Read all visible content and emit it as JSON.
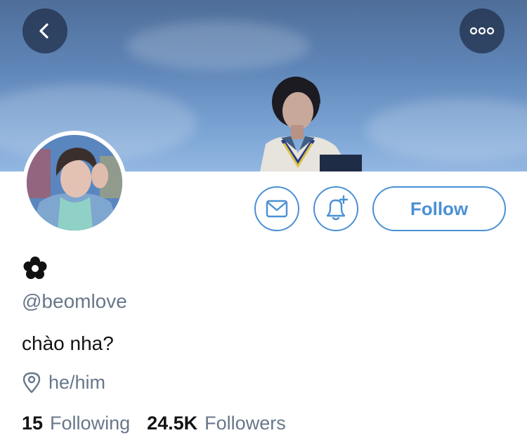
{
  "header": {
    "back_icon": "chevron-left-icon",
    "more_icon": "more-horizontal-icon"
  },
  "profile": {
    "display_name_icon": "flower-icon",
    "handle": "@beomlove",
    "bio": "chào nha?",
    "location_icon": "location-pin-icon",
    "location": "he/him"
  },
  "actions": {
    "message_icon": "envelope-icon",
    "notify_icon": "bell-plus-icon",
    "follow_label": "Follow"
  },
  "stats": {
    "following_count": "15",
    "following_label": "Following",
    "followers_count": "24.5K",
    "followers_label": "Followers"
  },
  "colors": {
    "accent": "#4a90d4",
    "secondary_text": "#68778a",
    "primary_text": "#141414"
  }
}
